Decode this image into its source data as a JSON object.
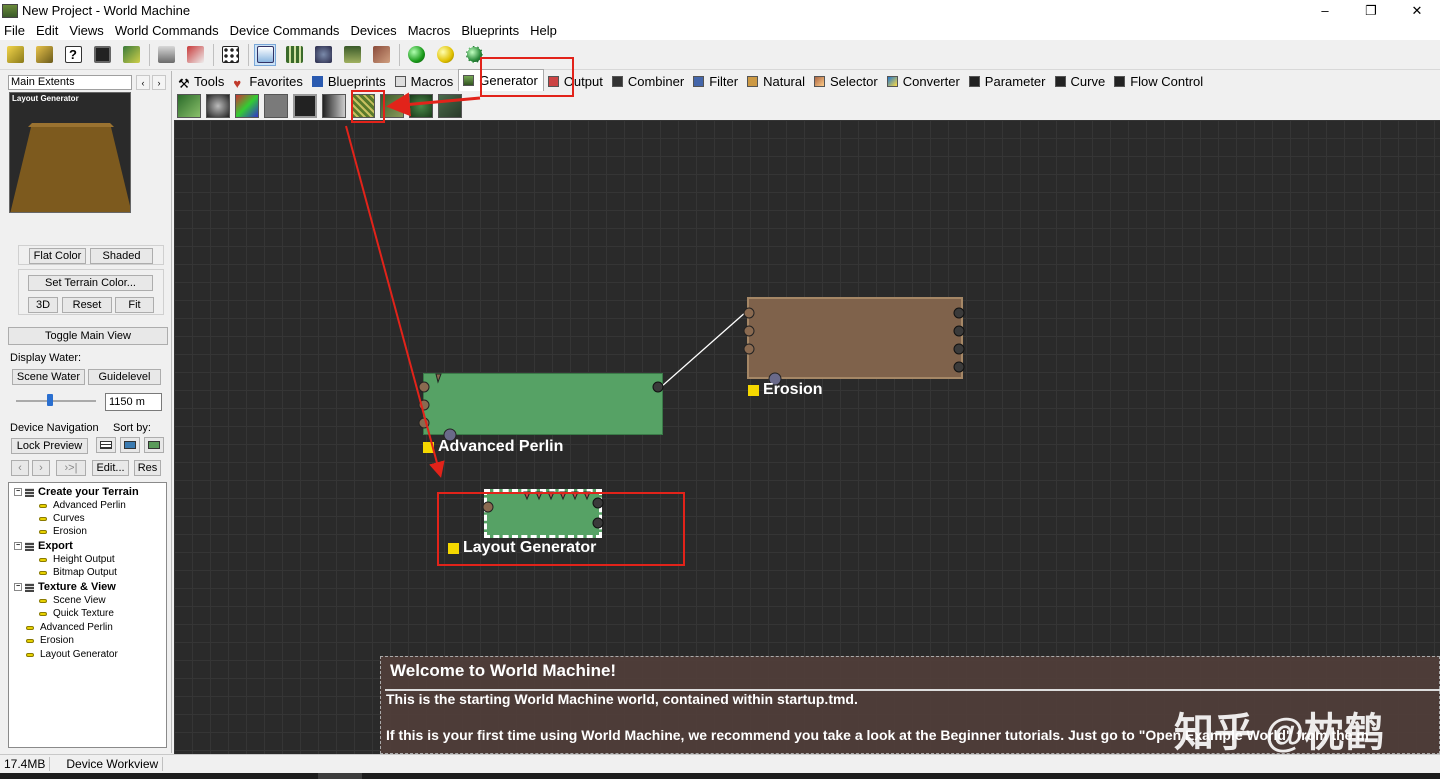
{
  "window": {
    "title": "New Project - World Machine",
    "controls": [
      "–",
      "❐",
      "✕"
    ]
  },
  "menu": [
    "File",
    "Edit",
    "Views",
    "World Commands",
    "Device Commands",
    "Devices",
    "Macros",
    "Blueprints",
    "Help"
  ],
  "toolbar": {
    "icons": [
      "new-project-icon",
      "open-project-icon",
      "help-icon",
      "save-icon",
      "checkmark-tool-icon",
      "build-icon",
      "macro-tool-icon",
      "dice-icon",
      "workview-icon",
      "layout-view-icon",
      "3d-view-icon",
      "terrain-view-icon",
      "texture-view-icon",
      "green-orb-icon",
      "yellow-orb-icon",
      "globe-orb-icon"
    ]
  },
  "left_panel": {
    "extents_label": "Main Extents",
    "arrows": [
      "‹",
      "›"
    ],
    "preview_label": "Layout Generator",
    "flat_color": "Flat Color",
    "shaded": "Shaded",
    "set_terrain_color": "Set Terrain Color...",
    "btn_3d": "3D",
    "btn_reset": "Reset",
    "btn_fit": "Fit",
    "toggle_main_view": "Toggle Main View",
    "display_water": "Display Water:",
    "scene_water": "Scene Water",
    "guidelevel": "Guidelevel",
    "water_level": "1150 m",
    "device_navigation": "Device Navigation",
    "sort_by": "Sort by:",
    "lock_preview": "Lock Preview",
    "nav_prev": "‹",
    "nav_next": "›",
    "nav_end": "›>|",
    "edit": "Edit...",
    "res": "Res",
    "tree": {
      "create_terrain": "Create your Terrain",
      "advanced_perlin": "Advanced Perlin",
      "curves": "Curves",
      "erosion": "Erosion",
      "export": "Export",
      "height_output": "Height Output",
      "bitmap_output": "Bitmap Output",
      "texture_view": "Texture & View",
      "scene_view": "Scene View",
      "quick_texture": "Quick Texture",
      "advanced_perlin_2": "Advanced Perlin",
      "erosion_2": "Erosion",
      "layout_generator": "Layout Generator"
    }
  },
  "tabs": [
    "Tools",
    "Favorites",
    "Blueprints",
    "Macros",
    "Generator",
    "Output",
    "Combiner",
    "Filter",
    "Natural",
    "Selector",
    "Converter",
    "Parameter",
    "Curve",
    "Flow Control"
  ],
  "active_tab": "Generator",
  "canvas": {
    "nodes": {
      "advanced_perlin": "Advanced Perlin",
      "erosion": "Erosion",
      "layout_generator": "Layout Generator"
    },
    "welcome": {
      "title": "Welcome to World Machine!",
      "line1": "This is the starting World Machine world, contained within startup.tmd.",
      "line2": "If this is your first time using World Machine, we recommend you take a look at the Beginner tutorials. Just go to \"Open Example World\" from the m"
    },
    "watermark": "知乎 @枕鹤"
  },
  "status": {
    "memory": "17.4MB",
    "mode": "Device Workview"
  },
  "colors": {
    "canvas_bg": "#2a2a2a",
    "perlin_node": "#56a265",
    "erosion_node": "#7f624b",
    "layout_node": "#56a265",
    "annotation_red": "#e2231a",
    "label_square": "#f5d800"
  }
}
